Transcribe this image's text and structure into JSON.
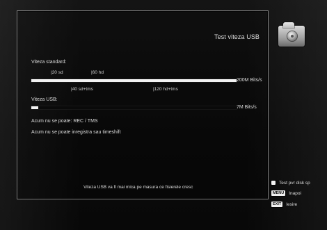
{
  "header": {
    "title": "Test viteza USB",
    "icon": "folder-disc-icon"
  },
  "standard": {
    "label": "Viteza standard:",
    "top_markers": [
      "|20 sd",
      "|60 hd"
    ],
    "bottom_markers": [
      "|40 sd+tms",
      "|120 hd+tms"
    ],
    "rate_label": "200M Bits/s",
    "bar_value_fraction": 1.0
  },
  "usb": {
    "label": "Viteza USB:",
    "rate_label": "7M Bits/s",
    "bar_value_fraction": 0.035
  },
  "messages": {
    "line1": "Acum nu se poate: REC / TMS",
    "line2": "Acum nu se poate inregistra sau timeshift",
    "footer": "Viteza USB va fi mai mica pe masura ce fisierele cresc"
  },
  "legend": {
    "items": [
      {
        "key": "",
        "text": "Test pvr disk sp",
        "key_style": "white"
      },
      {
        "key": "MENU",
        "text": "Inapoi",
        "key_style": "tag"
      },
      {
        "key": "EXIT",
        "text": "Iesire",
        "key_style": "tag"
      }
    ]
  }
}
